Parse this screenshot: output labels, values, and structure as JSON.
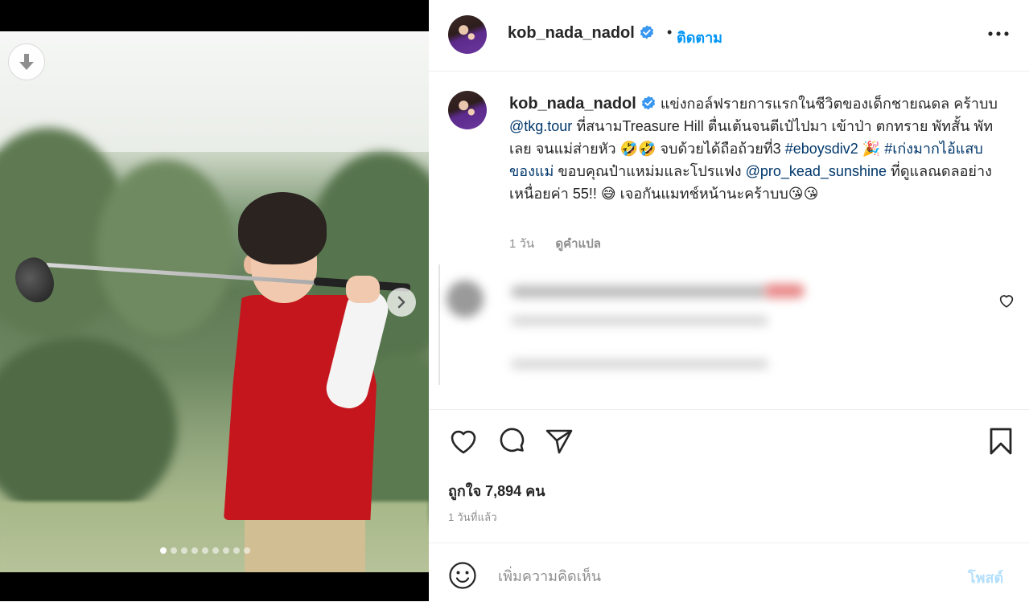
{
  "post": {
    "username": "kob_nada_nadol",
    "follow_label": "ติดตาม",
    "separator": "•",
    "caption_text_1": "แข่งกอล์ฟรายการแรกในชีวิตของเด็กชายณดล คร้าบบ ",
    "caption_mention_1": "@tkg.tour",
    "caption_text_2": " ที่สนามTreasure Hill ตื่นเต้นจนตีเป๋ไปมา เข้าป่า ตกทราย พัทสั้น พัทเลย จนแม่ส่ายหัว 🤣🤣 จบด้วยได้ถือถ้วยที่3 ",
    "caption_hashtag_1": "#eboysdiv2",
    "caption_emoji_party": " 🎉 ",
    "caption_hashtag_2": "#เก่งมากไอ้แสบของแม่",
    "caption_text_3": " ขอบคุณป๋าแหม่มและโปรแฟง ",
    "caption_mention_2": "@pro_kead_sunshine",
    "caption_text_4": " ที่ดูแลณดลอย่างเหนื่อยค่า 55!! 😅 เจอกันแมทช์หน้านะคร้าบบ😘😘",
    "caption_age": "1 วัน",
    "translate_label": "ดูคำแปล",
    "likes_label": "ถูกใจ 7,894 คน",
    "time_ago": "1 วันที่แล้ว",
    "comment_placeholder": "เพิ่มความคิดเห็น",
    "post_button": "โพสต์"
  },
  "media": {
    "carousel_total": 9,
    "carousel_active_index": 0
  },
  "colors": {
    "accent": "#0095f6",
    "link": "#00376b",
    "muted": "#8e8e8e",
    "post_disabled": "#b2dffc",
    "verified": "#3897f0"
  },
  "icons": [
    "download-icon",
    "chevron-right-icon",
    "verified-badge-icon",
    "more-options-icon",
    "heart-icon",
    "comment-icon",
    "share-icon",
    "bookmark-icon",
    "emoji-icon"
  ]
}
